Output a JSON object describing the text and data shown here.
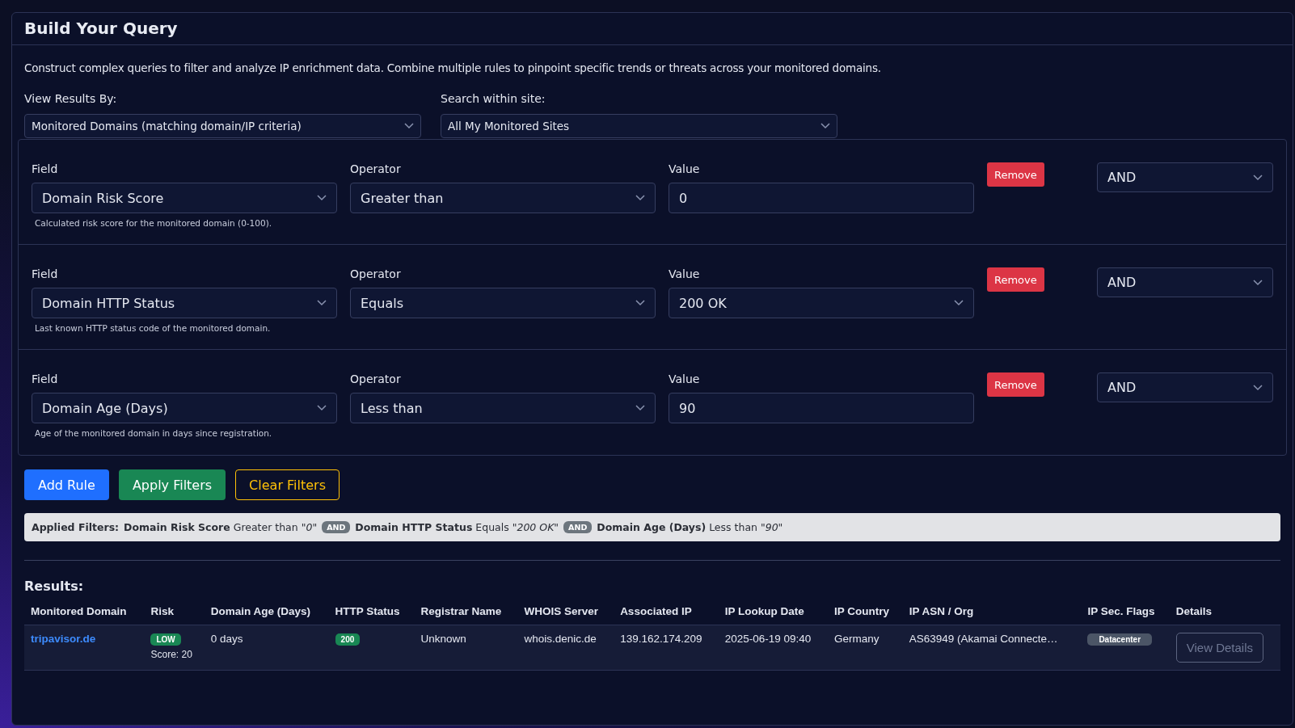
{
  "panel": {
    "title": "Build Your Query",
    "description": "Construct complex queries to filter and analyze IP enrichment data. Combine multiple rules to pinpoint specific trends or threats across your monitored domains."
  },
  "view_results_by": {
    "label": "View Results By:",
    "value": "Monitored Domains (matching domain/IP criteria)"
  },
  "search_within_site": {
    "label": "Search within site:",
    "value": "All My Monitored Sites"
  },
  "rules": [
    {
      "field_label": "Field",
      "field": "Domain Risk Score",
      "help": "Calculated risk score for the monitored domain (0-100).",
      "operator_label": "Operator",
      "operator": "Greater than",
      "value_label": "Value",
      "value": {
        "kind": "input",
        "text": "0"
      },
      "remove": "Remove",
      "connector": "AND"
    },
    {
      "field_label": "Field",
      "field": "Domain HTTP Status",
      "help": "Last known HTTP status code of the monitored domain.",
      "operator_label": "Operator",
      "operator": "Equals",
      "value_label": "Value",
      "value": {
        "kind": "select",
        "text": "200 OK"
      },
      "remove": "Remove",
      "connector": "AND"
    },
    {
      "field_label": "Field",
      "field": "Domain Age (Days)",
      "help": "Age of the monitored domain in days since registration.",
      "operator_label": "Operator",
      "operator": "Less than",
      "value_label": "Value",
      "value": {
        "kind": "input",
        "text": "90"
      },
      "remove": "Remove",
      "connector": "AND"
    }
  ],
  "actions": [
    {
      "label": "Add Rule",
      "kind": "primary"
    },
    {
      "label": "Apply Filters",
      "kind": "success"
    },
    {
      "label": "Clear Filters",
      "kind": "warning"
    }
  ],
  "applied_filters": {
    "label": "Applied Filters:",
    "items": [
      {
        "text": "**Domain Risk Score** Greater than \"*0*\"",
        "connector": "AND"
      },
      {
        "text": "**Domain HTTP Status** Equals \"*200 OK*\"",
        "connector": "AND"
      },
      {
        "text": "**Domain Age (Days)** Less than \"*90*\""
      }
    ]
  },
  "results": {
    "title": "Results:",
    "columns": [
      "Monitored Domain",
      "Risk",
      "Domain Age (Days)",
      "HTTP Status",
      "Registrar Name",
      "WHOIS Server",
      "Associated IP",
      "IP Lookup Date",
      "IP Country",
      "IP ASN / Org",
      "IP Sec. Flags",
      "Details"
    ],
    "rows": [
      {
        "domain": "tripavisor.de",
        "risk_badge": "LOW",
        "risk_score": "Score: 20",
        "domain_age": "0 days",
        "http_status": "200",
        "registrar": "Unknown",
        "whois_server": "whois.denic.de",
        "associated_ip": "139.162.174.209",
        "ip_lookup_date": "2025-06-19 09:40",
        "ip_country": "Germany",
        "ip_asn_org": "AS63949 (Akamai Connecte…",
        "ip_sec_flags": [
          "Datacenter"
        ],
        "details_button": "View Details"
      }
    ]
  }
}
